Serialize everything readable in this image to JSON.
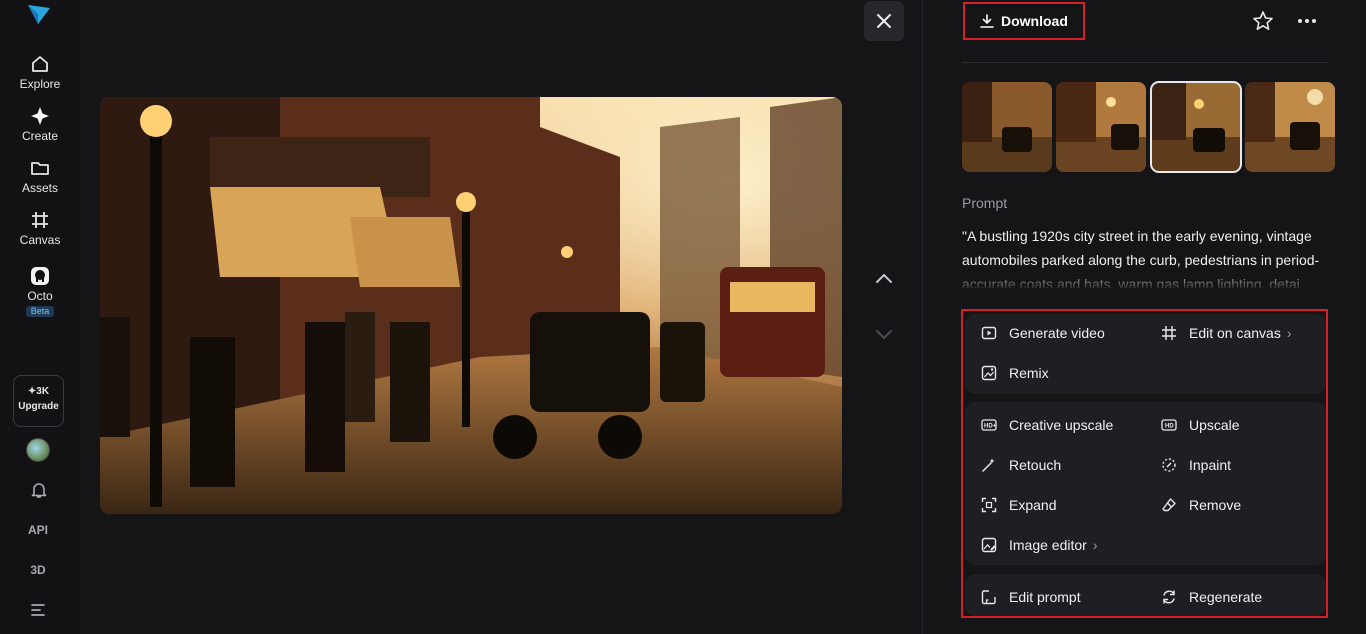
{
  "nav": {
    "items": [
      {
        "label": "Explore",
        "icon": "home-icon"
      },
      {
        "label": "Create",
        "icon": "sparkle-icon"
      },
      {
        "label": "Assets",
        "icon": "folder-icon"
      },
      {
        "label": "Canvas",
        "icon": "canvas-grid-icon"
      },
      {
        "label": "Octo",
        "icon": "octo-icon",
        "badge": "Beta"
      }
    ],
    "credits": "✦3K",
    "upgrade_label": "Upgrade",
    "api_label": "API",
    "three_d_label": "3D"
  },
  "viewer": {
    "image_alt": "1920s city street scene with vintage cars, tram and pedestrians",
    "close_icon": "close-icon"
  },
  "panel": {
    "download_label": "Download",
    "prompt_label": "Prompt",
    "prompt_text": "\"A bustling 1920s city street in the early evening, vintage automobiles parked along the curb, pedestrians in period-accurate coats and hats, warm gas lamp lighting, detai",
    "thumbnails_count": 4,
    "selected_thumbnail": 3
  },
  "actions": {
    "group1": [
      {
        "label": "Generate video",
        "icon": "play-video-icon"
      },
      {
        "label": "Edit on canvas",
        "icon": "canvas-grid-icon",
        "has_arrow": true
      },
      {
        "label": "Remix",
        "icon": "remix-image-icon"
      }
    ],
    "group2": [
      {
        "label": "Creative upscale",
        "icon": "hd-plus-icon"
      },
      {
        "label": "Upscale",
        "icon": "hd-icon"
      },
      {
        "label": "Retouch",
        "icon": "magic-wand-icon"
      },
      {
        "label": "Inpaint",
        "icon": "inpaint-circle-icon"
      },
      {
        "label": "Expand",
        "icon": "expand-icon"
      },
      {
        "label": "Remove",
        "icon": "eraser-icon"
      },
      {
        "label": "Image editor",
        "icon": "image-editor-icon",
        "has_arrow": true
      }
    ],
    "group3": [
      {
        "label": "Edit prompt",
        "icon": "edit-prompt-icon"
      },
      {
        "label": "Regenerate",
        "icon": "regenerate-icon"
      }
    ]
  },
  "colors": {
    "background": "#151518",
    "panel_group": "#1f1f23",
    "highlight_border": "#d3202a",
    "beta_badge": "#6ec3ff"
  }
}
